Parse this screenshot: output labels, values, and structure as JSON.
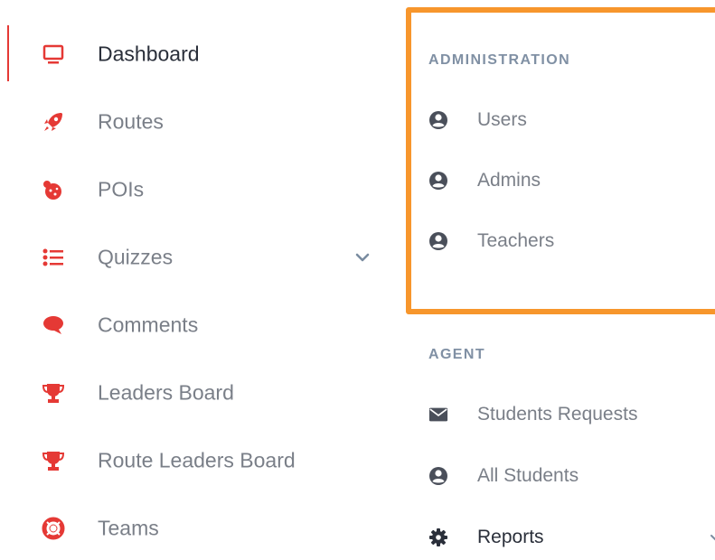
{
  "colors": {
    "accent": "#e53935",
    "highlight_border": "#f7962c",
    "section_title": "#8090a4",
    "icon_gray": "#4a4f5a"
  },
  "left_nav": {
    "items": [
      {
        "label": "Dashboard",
        "icon": "monitor-icon",
        "active": true
      },
      {
        "label": "Routes",
        "icon": "rocket-icon"
      },
      {
        "label": "POIs",
        "icon": "globe-pin-icon"
      },
      {
        "label": "Quizzes",
        "icon": "list-icon",
        "expandable": true
      },
      {
        "label": "Comments",
        "icon": "comment-icon"
      },
      {
        "label": "Leaders Board",
        "icon": "trophy-icon"
      },
      {
        "label": "Route Leaders Board",
        "icon": "trophy-icon"
      },
      {
        "label": "Teams",
        "icon": "life-ring-icon"
      }
    ]
  },
  "administration": {
    "title": "ADMINISTRATION",
    "items": [
      {
        "label": "Users",
        "icon": "user-circle-icon"
      },
      {
        "label": "Admins",
        "icon": "user-circle-icon"
      },
      {
        "label": "Teachers",
        "icon": "user-circle-icon"
      }
    ]
  },
  "agent": {
    "title": "AGENT",
    "items": [
      {
        "label": "Students Requests",
        "icon": "envelope-icon"
      },
      {
        "label": "All Students",
        "icon": "user-circle-icon"
      },
      {
        "label": "Reports",
        "icon": "gear-icon",
        "expandable": true
      }
    ]
  }
}
